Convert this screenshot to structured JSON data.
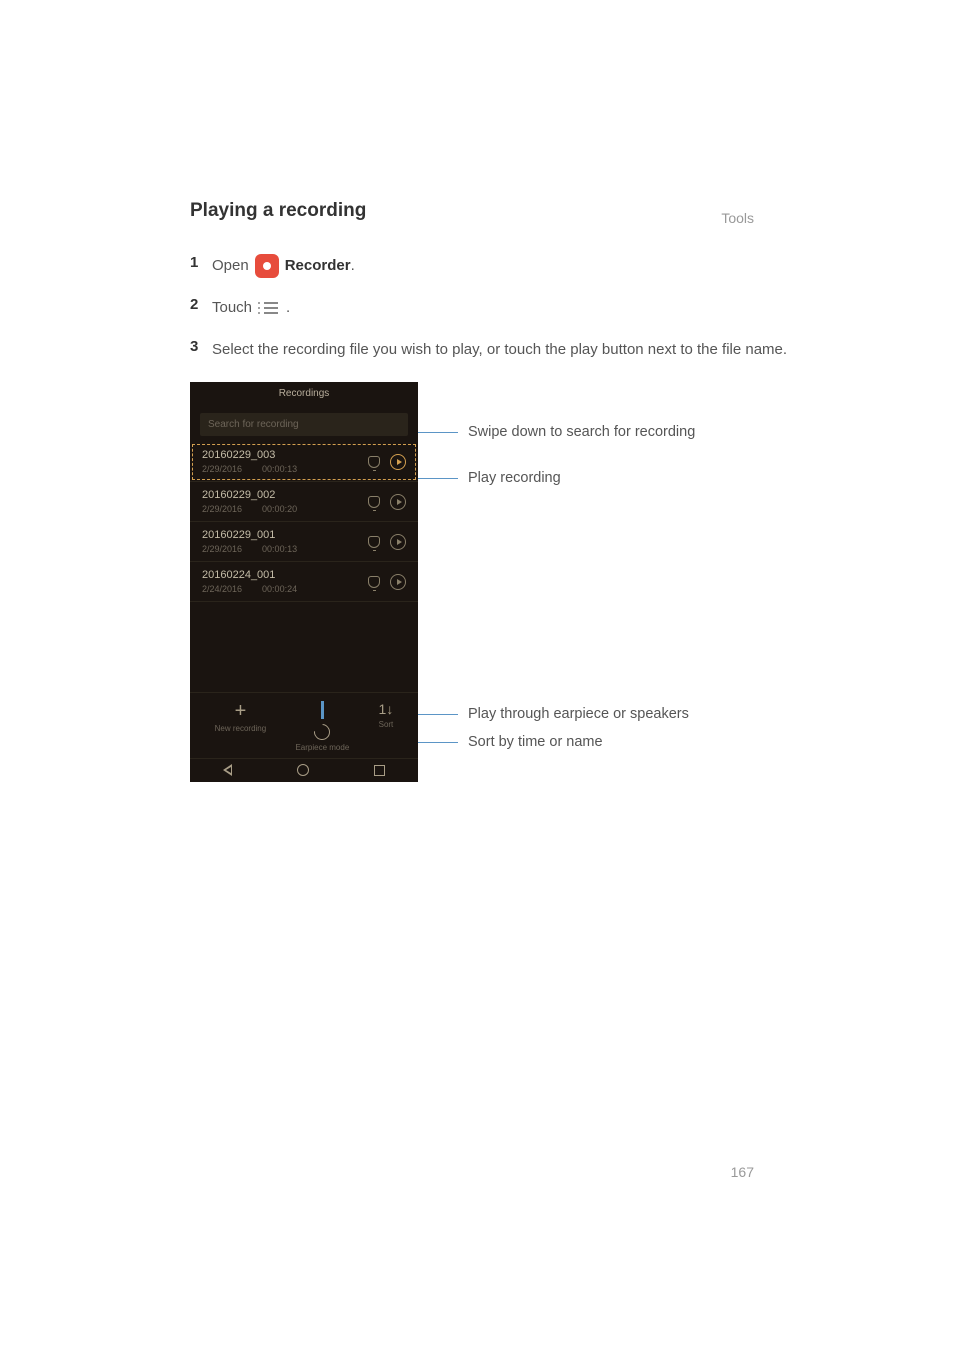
{
  "header_label": "Tools",
  "page_number": "167",
  "section_title": "Playing  a  recording",
  "steps": {
    "s1_open": "Open ",
    "s1_recorder": "Recorder",
    "s1_period": ".",
    "s2_touch": "Touch ",
    "s2_period": " .",
    "s3": "Select the recording file you wish to play, or touch the play button next to the file name."
  },
  "phone": {
    "title": "Recordings",
    "search_placeholder": "Search for recording",
    "items": [
      {
        "name": "20160229_003",
        "date": "2/29/2016",
        "dur": "00:00:13"
      },
      {
        "name": "20160229_002",
        "date": "2/29/2016",
        "dur": "00:00:20"
      },
      {
        "name": "20160229_001",
        "date": "2/29/2016",
        "dur": "00:00:13"
      },
      {
        "name": "20160224_001",
        "date": "2/24/2016",
        "dur": "00:00:24"
      }
    ],
    "bottom": {
      "new_label": "New recording",
      "earpiece_label": "Earpiece mode",
      "sort_label": "Sort"
    }
  },
  "annotations": {
    "a_search": "Swipe down to search for recording",
    "a_play": "Play recording",
    "a_speaker": "Play through earpiece or speakers",
    "a_sort": "Sort by time or name"
  }
}
